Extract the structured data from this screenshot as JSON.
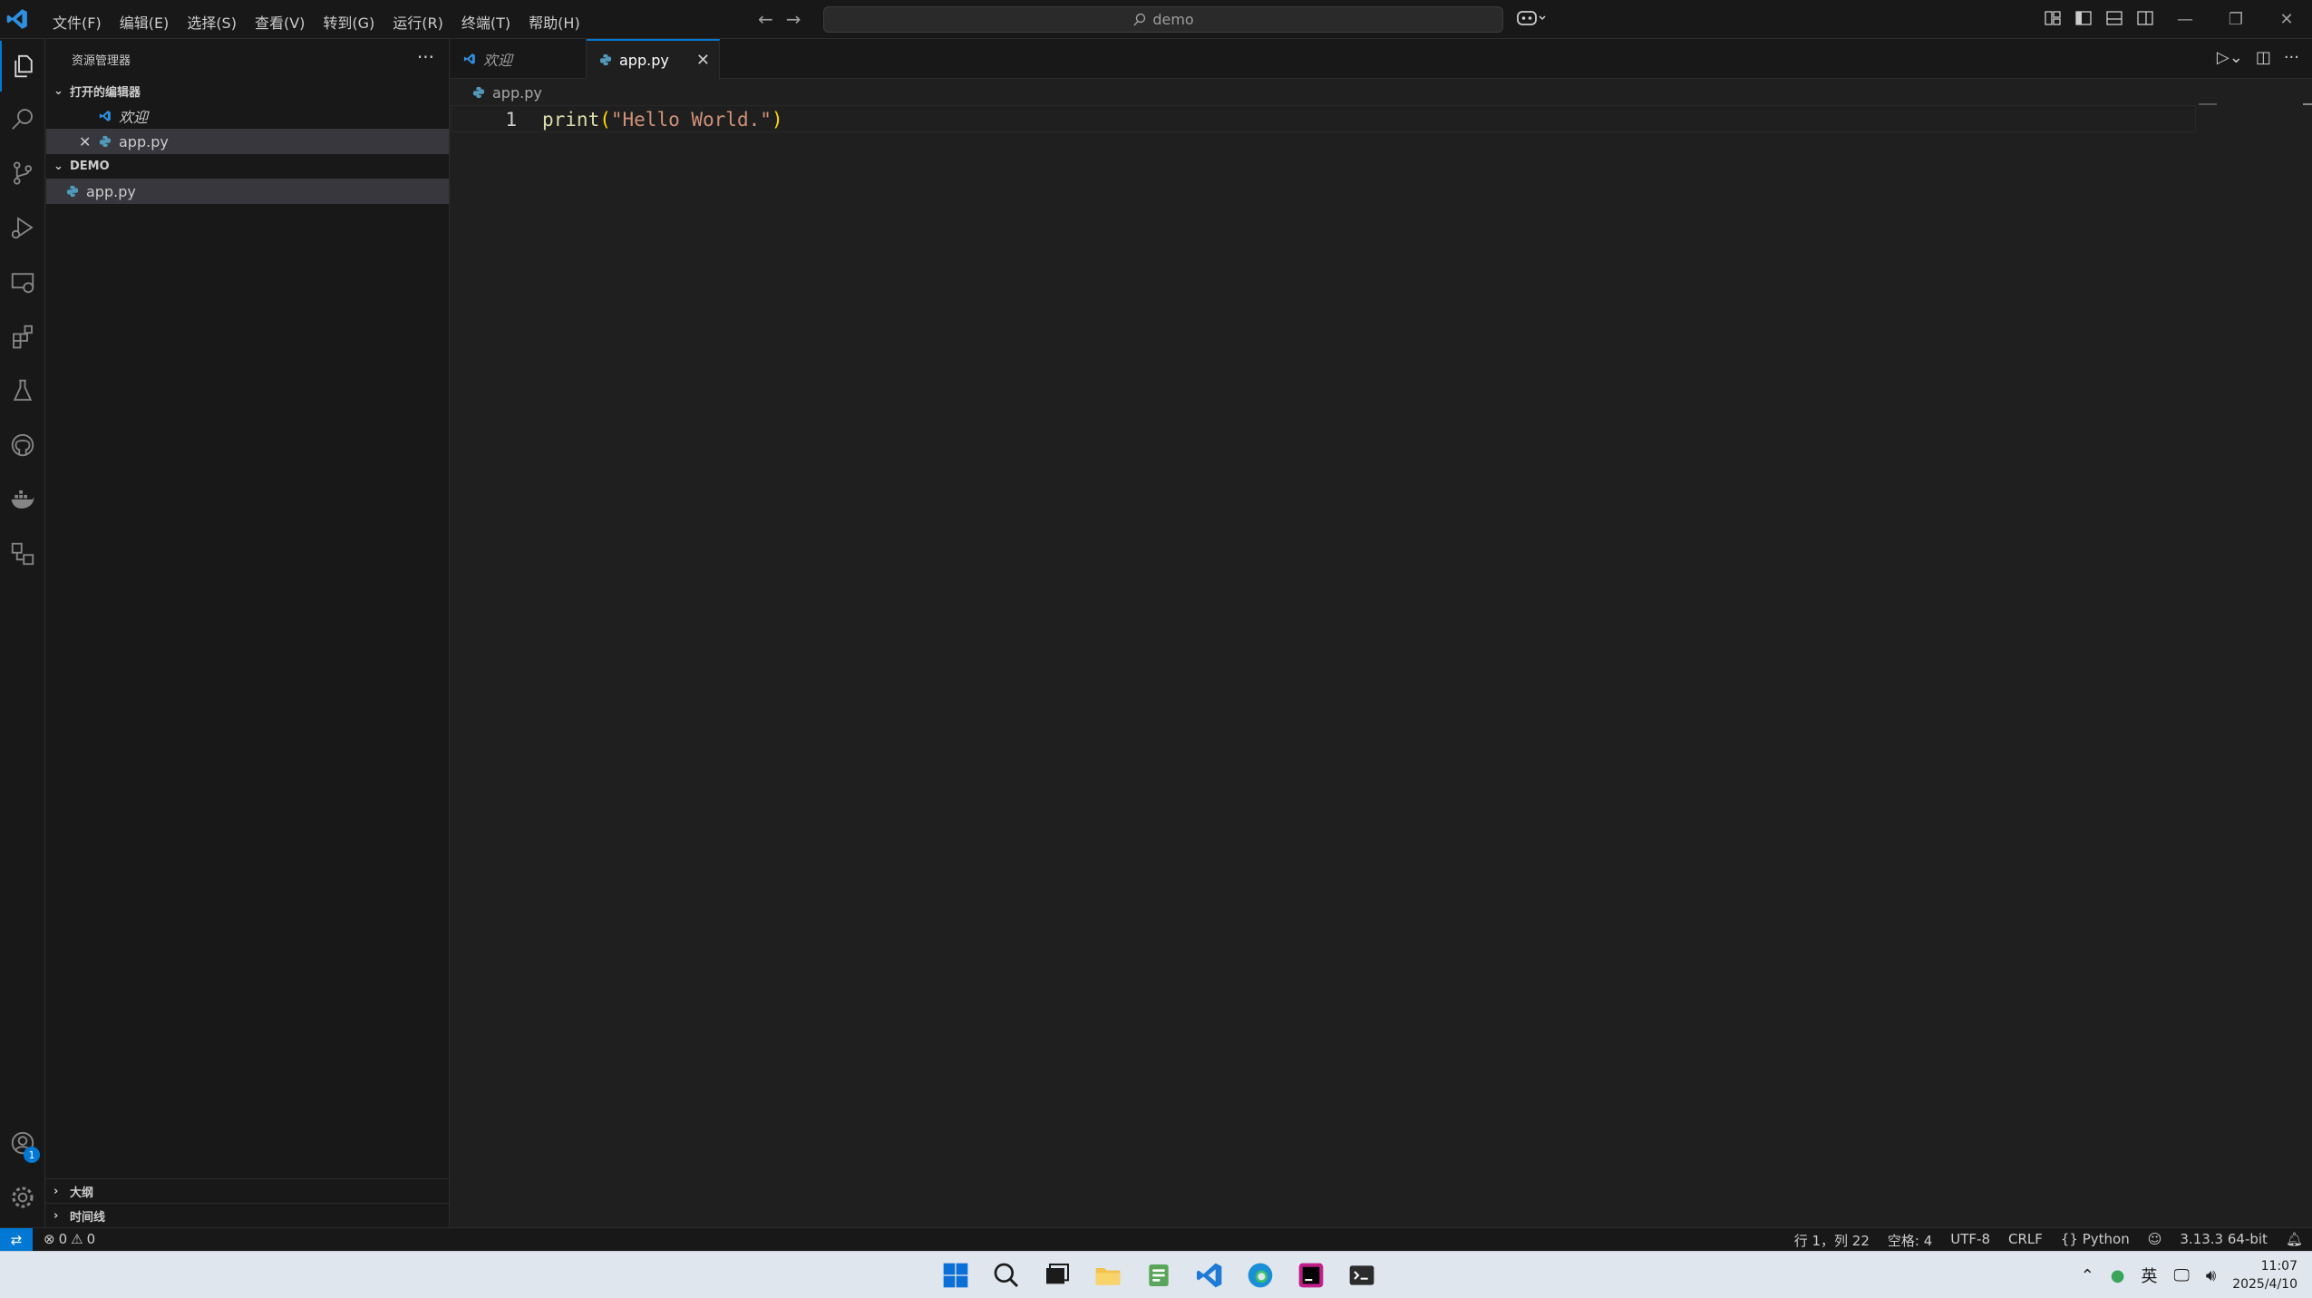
{
  "titlebar": {
    "menu": [
      "文件(F)",
      "编辑(E)",
      "选择(S)",
      "查看(V)",
      "转到(G)",
      "运行(R)",
      "终端(T)",
      "帮助(H)"
    ],
    "search_text": "demo"
  },
  "sidebar": {
    "title": "资源管理器",
    "open_editors_title": "打开的编辑器",
    "open_editors": [
      {
        "label": "欢迎"
      },
      {
        "label": "app.py"
      }
    ],
    "folder_title": "DEMO",
    "files": [
      {
        "label": "app.py"
      }
    ],
    "outline_title": "大纲",
    "timeline_title": "时间线"
  },
  "tabs": [
    {
      "label": "欢迎"
    },
    {
      "label": "app.py"
    }
  ],
  "breadcrumb": "app.py",
  "editor": {
    "line_number": "1",
    "code_fn": "print",
    "code_open": "(",
    "code_str": "\"Hello World.\"",
    "code_close": ")"
  },
  "accounts_badge": "1",
  "statusbar": {
    "errors": "0",
    "warnings": "0",
    "position": "行 1，列 22",
    "spaces": "空格: 4",
    "encoding": "UTF-8",
    "eol": "CRLF",
    "language": "{} Python",
    "interpreter": "3.13.3 64-bit"
  },
  "taskbar": {
    "ime": "英",
    "time": "11:07",
    "date": "2025/4/10"
  },
  "colors": {
    "accent": "#0078d4",
    "editor_bg": "#1f1f1f",
    "sidebar_bg": "#181818",
    "string": "#ce9178",
    "function": "#dcdcaa"
  }
}
